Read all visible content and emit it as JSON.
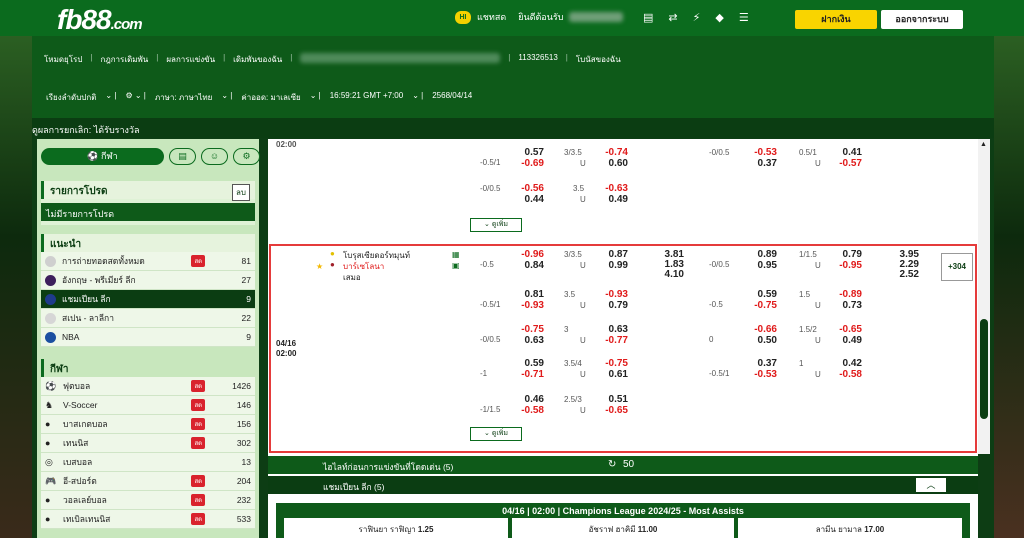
{
  "topbar": {
    "logo_main": "fb88",
    "logo_dot": ".com",
    "chat_label": "แชทสด",
    "welcome": "ยินดีต้อนรับ",
    "deposit": "ฝากเงิน",
    "logout": "ออกจากระบบ"
  },
  "header": {
    "nav": [
      "โหมดยุโรป",
      "กฎการเดิมพัน",
      "ผลการแข่งขัน",
      "เดิมพันของฉัน"
    ],
    "account_id": "113326513",
    "bonus": "โบนัสของฉัน",
    "sort": "เรียงลำดับปกติ",
    "language": "ภาษา: ภาษาไทย",
    "odds": "ค่าออด: มาเลเซีย",
    "time": "16:59:21 GMT +7:00",
    "date": "2568/04/14"
  },
  "banner": "ดูผลการยกเลิก: ได้รับรางวัล",
  "sidebar": {
    "sport_btn": "กีฬา",
    "mybets_title": "รายการโปรด",
    "mybets_btn": "ลบ",
    "mybets_empty": "ไม่มีรายการโปรด",
    "rec_title": "แนะนำ",
    "live_label": "สด",
    "recommended": [
      {
        "name": "การถ่ายทอดสดทั้งหมด",
        "count": "81",
        "live": true
      },
      {
        "name": "อังกฤษ - พรีเมียร์ ลีก",
        "count": "27",
        "live": false
      },
      {
        "name": "แชมเปียน ลีก",
        "count": "9",
        "live": false,
        "selected": true
      },
      {
        "name": "สเปน - ลาลีกา",
        "count": "22",
        "live": false
      },
      {
        "name": "NBA",
        "count": "9",
        "live": false
      }
    ],
    "sports_title": "กีฬา",
    "sports": [
      {
        "name": "ฟุตบอล",
        "count": "1426"
      },
      {
        "name": "V-Soccer",
        "count": "146"
      },
      {
        "name": "บาสเกตบอล",
        "count": "156"
      },
      {
        "name": "เทนนิส",
        "count": "302"
      },
      {
        "name": "เบสบอล",
        "count": "13"
      },
      {
        "name": "อี-สปอร์ต",
        "count": "204"
      },
      {
        "name": "วอลเลย์บอล",
        "count": "232"
      },
      {
        "name": "เทเบิลเทนนิส",
        "count": "533"
      }
    ]
  },
  "match1": {
    "time": "02:00",
    "rows": [
      {
        "hdp": "",
        "h": "0.57",
        "hr": false,
        "a": "-0.69",
        "ar": true,
        "ou": "3/3.5",
        "o": "-0.74",
        "or": true,
        "u": "0.60",
        "ur": false,
        "fh_hdp": "-0/0.5",
        "fh": "-0.53",
        "fhr": true,
        "fa": "0.37",
        "far": false,
        "fou": "0.5/1",
        "fo": "0.41",
        "for": false,
        "fu": "-0.57",
        "fur": true,
        "hdp2": "-0.5/1"
      },
      {
        "hdp": "-0/0.5",
        "h": "-0.56",
        "hr": true,
        "a": "0.44",
        "ar": false,
        "ou": "3.5",
        "o": "-0.63",
        "or": true,
        "u": "0.49",
        "ur": false
      }
    ],
    "more": "ดูเพิ่ม"
  },
  "match2": {
    "date": "04/16",
    "time": "02:00",
    "home": "โบรุสเซียดอร์ทมุนท์",
    "away": "บาร์เซโลนา",
    "draw": "เสมอ",
    "more_markets": "+304",
    "x12": [
      "3.81",
      "1.83",
      "4.10"
    ],
    "fh_x12": [
      "3.95",
      "2.29",
      "2.52"
    ],
    "rows": [
      {
        "hdp": "-0.5",
        "h": "-0.96",
        "hr": true,
        "a": "0.84",
        "ar": false,
        "ou": "3/3.5",
        "o": "0.87",
        "or": false,
        "u": "0.99",
        "ur": false,
        "fhdp": "-0/0.5",
        "fh": "0.89",
        "fhr": false,
        "fa": "0.95",
        "far": false,
        "fou": "1/1.5",
        "fo": "0.79",
        "for": false,
        "fu": "-0.95",
        "fur": true
      },
      {
        "hdp": "-0.5/1",
        "h": "0.81",
        "hr": false,
        "a": "-0.93",
        "ar": true,
        "ou": "3.5",
        "o": "-0.93",
        "or": true,
        "u": "0.79",
        "ur": false,
        "fhdp": "-0.5",
        "fh": "0.59",
        "fhr": false,
        "fa": "-0.75",
        "far": true,
        "fou": "1.5",
        "fo": "-0.89",
        "for": true,
        "fu": "0.73",
        "fur": false
      },
      {
        "hdp": "-0/0.5",
        "h": "-0.75",
        "hr": true,
        "a": "0.63",
        "ar": false,
        "ou": "3",
        "o": "0.63",
        "or": false,
        "u": "-0.77",
        "ur": true,
        "fhdp": "0",
        "fh": "-0.66",
        "fhr": true,
        "fa": "0.50",
        "far": false,
        "fou": "1.5/2",
        "fo": "-0.65",
        "for": true,
        "fu": "0.49",
        "fur": false
      },
      {
        "hdp": "-1",
        "h": "0.59",
        "hr": false,
        "a": "-0.71",
        "ar": true,
        "ou": "3.5/4",
        "o": "-0.75",
        "or": true,
        "u": "0.61",
        "ur": false,
        "fhdp": "-0.5/1",
        "fh": "0.37",
        "fhr": false,
        "fa": "-0.53",
        "far": true,
        "fou": "1",
        "fo": "0.42",
        "for": false,
        "fu": "-0.58",
        "fur": true
      },
      {
        "hdp": "-1/1.5",
        "h": "0.46",
        "hr": false,
        "a": "-0.58",
        "ar": true,
        "ou": "2.5/3",
        "o": "0.51",
        "or": false,
        "u": "-0.65",
        "ur": true
      }
    ],
    "under": "U",
    "more": "ดูเพิ่ม"
  },
  "bars": {
    "live_title": "ไฮไลท์ก่อนการแข่งขันที่โดดเด่น (5)",
    "live_count": "50",
    "cl_title": "แชมเปียน ลีก (5)"
  },
  "outright": {
    "title": "04/16 | 02:00 | Champions League 2024/25 - Most Assists",
    "cells": [
      {
        "name": "ราฟินยา ราฟิญา",
        "odds": "1.25"
      },
      {
        "name": "อัชราฟ ฮาคิมี",
        "odds": "11.00"
      },
      {
        "name": "ลามีน ยามาล",
        "odds": "17.00"
      }
    ]
  }
}
